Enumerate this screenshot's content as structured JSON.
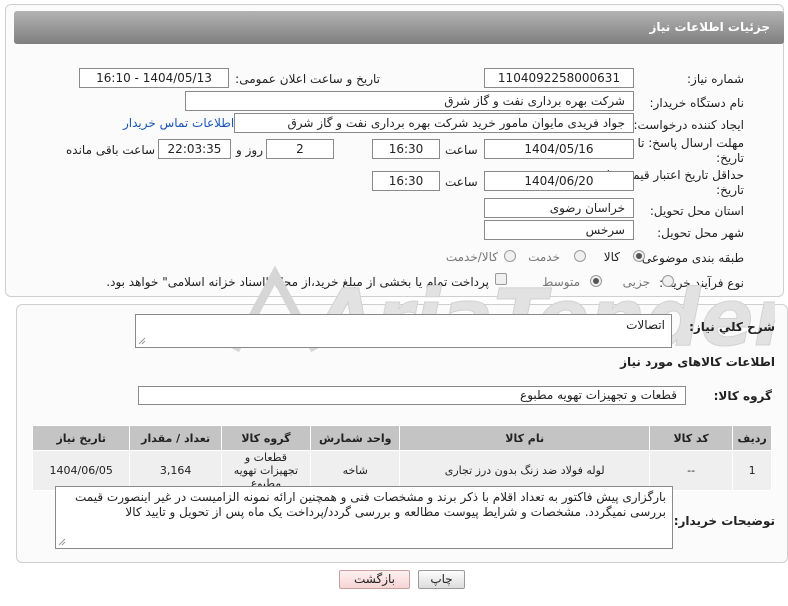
{
  "header": {
    "title": "جزئیات اطلاعات نیاز"
  },
  "fields": {
    "need_number_label": "شماره نیاز:",
    "need_number": "1104092258000631",
    "announce_label": "تاریخ و ساعت اعلان عمومی:",
    "announce_value": "1404/05/13 - 16:10",
    "buyer_org_label": "نام دستگاه خریدار:",
    "buyer_org": "شرکت بهره برداری نفت و گاز شرق",
    "creator_label": "ایجاد کننده درخواست:",
    "creator": "جواد فریدی مایوان مامور خرید شرکت بهره برداری نفت و گاز شرق",
    "contact_link": "اطلاعات تماس خریدار",
    "reply_deadline_label": "مهلت ارسال پاسخ: تا تاریخ:",
    "reply_date": "1404/05/16",
    "time_label": "ساعت",
    "reply_time": "16:30",
    "days_value": "2",
    "days_label": "روز و",
    "remaining_time": "22:03:35",
    "remaining_label": "ساعت باقی مانده",
    "price_validity_label": "حداقل تاریخ اعتبار قیمت: تا تاریخ:",
    "price_date": "1404/06/20",
    "price_time": "16:30",
    "province_label": "استان محل تحویل:",
    "province": "خراسان رضوی",
    "city_label": "شهر محل تحویل:",
    "city": "سرخس",
    "category_label": "طبقه بندی موضوعی:",
    "category_options": [
      "کالا",
      "خدمت",
      "کالا/خدمت"
    ],
    "process_label": "نوع فرآیند خرید :",
    "process_options": [
      "جزیی",
      "متوسط"
    ],
    "payment_note": "پرداخت تمام یا بخشی از مبلغ خرید،از محل \"اسناد خزانه اسلامی\" خواهد بود."
  },
  "description": {
    "label": "شرح کلي نياز:",
    "value": "اتصالات"
  },
  "goods": {
    "section_title": "اطلاعات کالاهای مورد نیاز",
    "group_label": "گروه کالا:",
    "group_value": "قطعات و تجهیزات تهویه مطبوع"
  },
  "table": {
    "headers": [
      "ردیف",
      "کد کالا",
      "نام کالا",
      "واحد شمارش",
      "گروه کالا",
      "تعداد / مقدار",
      "تاریخ نیاز"
    ],
    "rows": [
      [
        "1",
        "--",
        "لوله فولاد ضد زنگ بدون درز تجاری",
        "شاخه",
        "قطعات و تجهیزات تهویه مطبوع",
        "3,164",
        "1404/06/05"
      ]
    ]
  },
  "buyer_notes": {
    "label": "توضیحات خریدار:",
    "value": "بارگزاری پیش فاکتور به تعداد اقلام با ذکر برند و مشخصات فنی و همچنین ارائه نمونه  الزامیست در غیر اینصورت قیمت بررسی نمیگردد. مشخصات و شرایط پیوست مطالعه و بررسی گردد/پرداخت یک ماه پس از تحویل و تایید کالا"
  },
  "buttons": {
    "print": "چاپ",
    "back": "بازگشت"
  },
  "watermark": {
    "text": "AriaTender.neT"
  },
  "colors": {
    "header_bg": "#8f8f8f",
    "link": "#1a55b8",
    "watermark": "#d9d9d9"
  }
}
